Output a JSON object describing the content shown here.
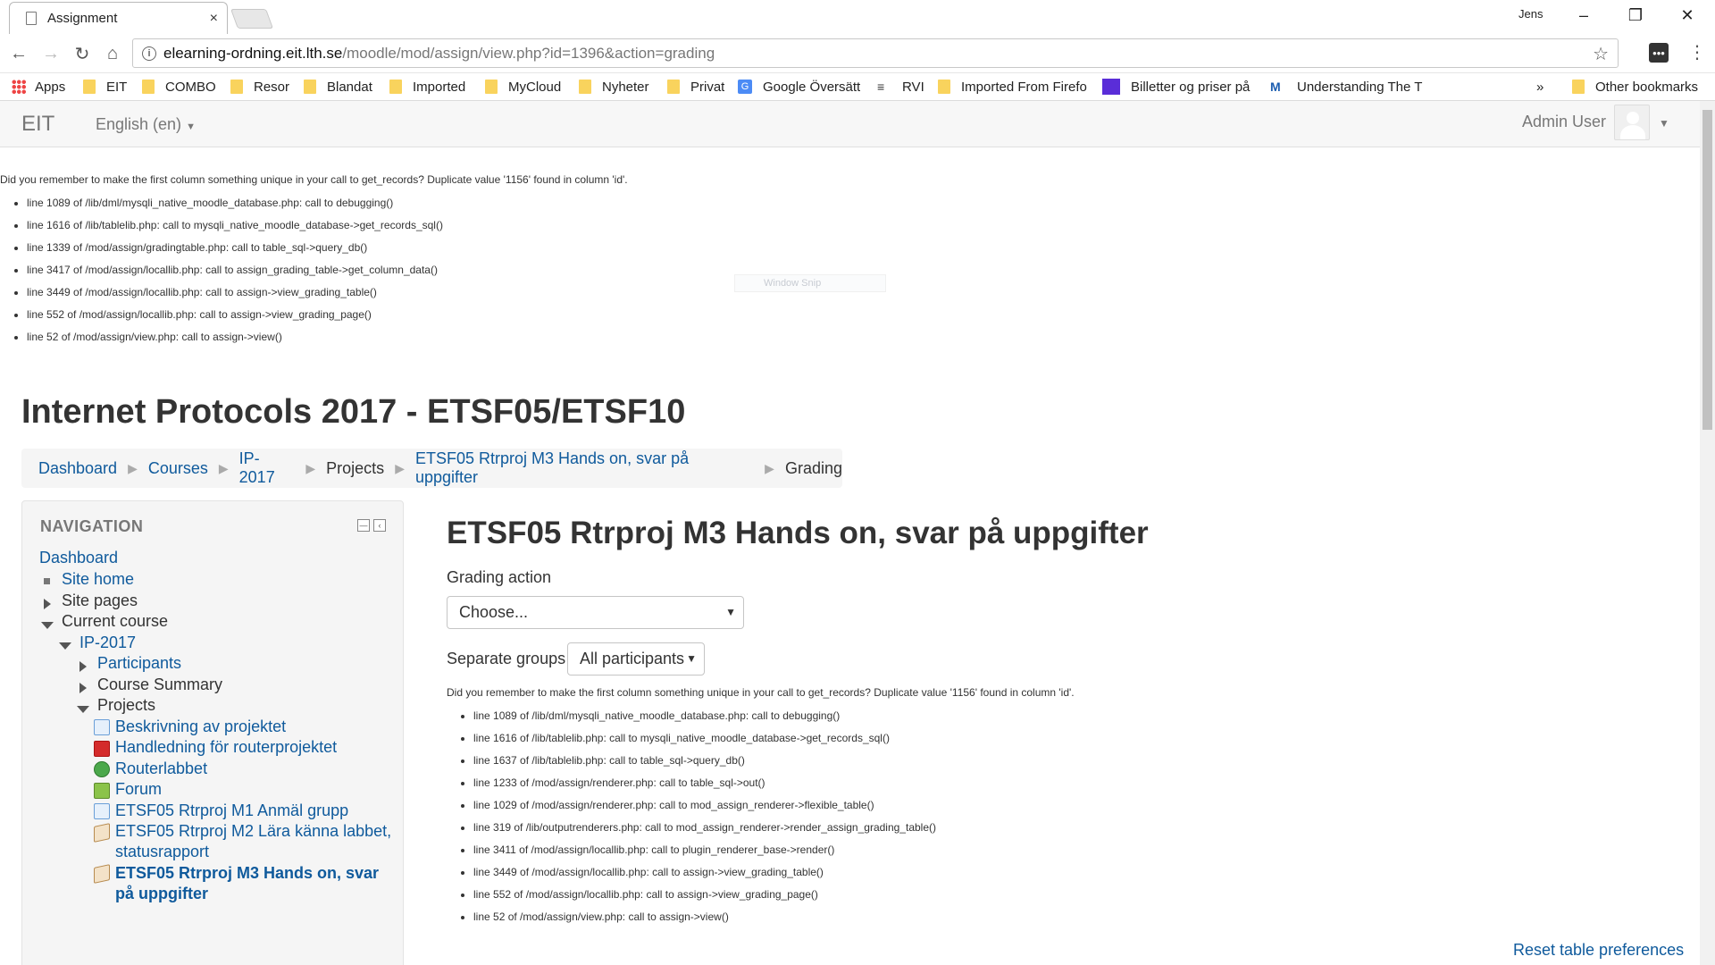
{
  "browser": {
    "tab_title": "Assignment",
    "tab_close": "×",
    "window_user": "Jens",
    "url_host": "elearning-ordning.eit.lth.se",
    "url_path": "/moodle/mod/assign/view.php?id=1396&action=grading",
    "bookmarks": {
      "apps": "Apps",
      "eit": "EIT",
      "combo": "COMBO",
      "resor": "Resor",
      "blandat": "Blandat",
      "imported": "Imported",
      "mycloud": "MyCloud",
      "nyheter": "Nyheter",
      "privat": "Privat",
      "google_translate": "Google Översätt",
      "rvi": "RVI",
      "imported_firefox": "Imported From Firefo",
      "billetter": "Billetter og priser på",
      "understanding": "Understanding The T",
      "overflow": "»",
      "other": "Other bookmarks"
    }
  },
  "moodle": {
    "brand": "EIT",
    "language": "English (en)",
    "user_name": "Admin User"
  },
  "debug_top": {
    "message": "Did you remember to make the first column something unique in your call to get_records? Duplicate value '1156' found in column 'id'.",
    "lines": [
      "line 1089 of /lib/dml/mysqli_native_moodle_database.php: call to debugging()",
      "line 1616 of /lib/tablelib.php: call to mysqli_native_moodle_database->get_records_sql()",
      "line 1339 of /mod/assign/gradingtable.php: call to table_sql->query_db()",
      "line 3417 of /mod/assign/locallib.php: call to assign_grading_table->get_column_data()",
      "line 3449 of /mod/assign/locallib.php: call to assign->view_grading_table()",
      "line 552 of /mod/assign/locallib.php: call to assign->view_grading_page()",
      "line 52 of /mod/assign/view.php: call to assign->view()"
    ]
  },
  "ghost_overlay": "Window Snip",
  "course_title": "Internet Protocols 2017 - ETSF05/ETSF10",
  "breadcrumb": {
    "dashboard": "Dashboard",
    "courses": "Courses",
    "ip2017": "IP-2017",
    "projects": "Projects",
    "assignment": "ETSF05 Rtrproj M3 Hands on, svar på uppgifter",
    "grading": "Grading",
    "separator": "▶"
  },
  "navigation": {
    "header": "NAVIGATION",
    "dashboard": "Dashboard",
    "site_home": "Site home",
    "site_pages": "Site pages",
    "current_course": "Current course",
    "ip2017": "IP-2017",
    "participants": "Participants",
    "course_summary": "Course Summary",
    "projects": "Projects",
    "activities": {
      "beskrivning": "Beskrivning av projektet",
      "handledning": "Handledning för routerprojektet",
      "routerlabbet": "Routerlabbet",
      "forum": "Forum",
      "m1": "ETSF05 Rtrproj M1 Anmäl grupp",
      "m2_line1": "ETSF05 Rtrproj M2 Lära känna labbet,",
      "m2_line2": "statusrapport",
      "m3_line1": "ETSF05 Rtrproj M3 Hands on, svar",
      "m3_line2": "på uppgifter"
    }
  },
  "main": {
    "title": "ETSF05 Rtrproj M3 Hands on, svar på uppgifter",
    "grading_action_label": "Grading action",
    "grading_action_value": "Choose...",
    "separate_groups_label": "Separate groups",
    "separate_groups_value": "All participants",
    "reset_link": "Reset table preferences"
  },
  "debug_main": {
    "message": "Did you remember to make the first column something unique in your call to get_records? Duplicate value '1156' found in column 'id'.",
    "lines": [
      "line 1089 of /lib/dml/mysqli_native_moodle_database.php: call to debugging()",
      "line 1616 of /lib/tablelib.php: call to mysqli_native_moodle_database->get_records_sql()",
      "line 1637 of /lib/tablelib.php: call to table_sql->query_db()",
      "line 1233 of /mod/assign/renderer.php: call to table_sql->out()",
      "line 1029 of /mod/assign/renderer.php: call to mod_assign_renderer->flexible_table()",
      "line 319 of /lib/outputrenderers.php: call to mod_assign_renderer->render_assign_grading_table()",
      "line 3411 of /mod/assign/locallib.php: call to plugin_renderer_base->render()",
      "line 3449 of /mod/assign/locallib.php: call to assign->view_grading_table()",
      "line 552 of /mod/assign/locallib.php: call to assign->view_grading_page()",
      "line 52 of /mod/assign/view.php: call to assign->view()"
    ]
  }
}
